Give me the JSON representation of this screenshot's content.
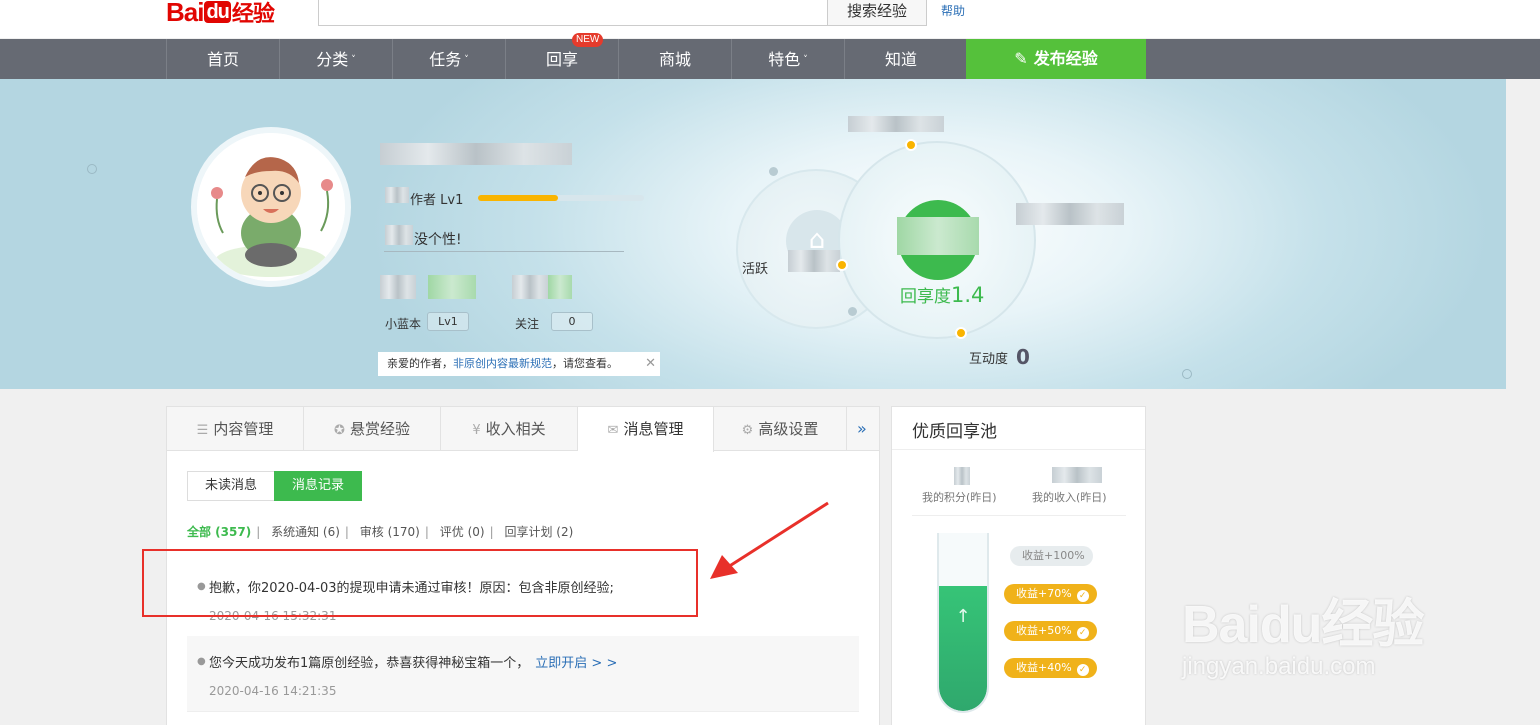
{
  "header": {
    "logo_text_bai": "Bai",
    "logo_text_du": "du",
    "logo_text_jy": "经验",
    "search_button": "搜索经验",
    "help_link": "帮助"
  },
  "nav": {
    "items": [
      {
        "label": "首页",
        "caret": false
      },
      {
        "label": "分类",
        "caret": true
      },
      {
        "label": "任务",
        "caret": true
      },
      {
        "label": "回享",
        "caret": false
      },
      {
        "label": "商城",
        "caret": false
      },
      {
        "label": "特色",
        "caret": true
      },
      {
        "label": "知道",
        "caret": false
      }
    ],
    "new_badge": "NEW",
    "publish_button": "发布经验"
  },
  "profile": {
    "author_level": "作者 Lv1",
    "level_progress_percent": 48,
    "signature": "没个性!",
    "xiaolanben_label": "小蓝本",
    "xiaolanben_value": "Lv1",
    "follow_label": "关注",
    "follow_value": "0",
    "notice_prefix": "亲爱的作者，",
    "notice_link": "非原创内容最新规范",
    "notice_suffix": "，请您查看。",
    "notice_close": "✕"
  },
  "stats": {
    "huoyue_label": "活跃",
    "huixiang_label": "回享度",
    "huixiang_value": "1.4",
    "hudong_label": "互动度",
    "hudong_value": "0"
  },
  "tabs": [
    {
      "label": "内容管理",
      "icon": "list-icon"
    },
    {
      "label": "悬赏经验",
      "icon": "medal-icon"
    },
    {
      "label": "收入相关",
      "icon": "yen-icon"
    },
    {
      "label": "消息管理",
      "icon": "mail-icon",
      "active": true
    },
    {
      "label": "高级设置",
      "icon": "gear-icon"
    }
  ],
  "tab_more": "»",
  "subtabs": {
    "unread": "未读消息",
    "record": "消息记录"
  },
  "filters": {
    "all": "全部 (357)",
    "system": "系统通知 (6)",
    "review": "审核 (170)",
    "evaluate": "评优 (0)",
    "plan": "回享计划 (2)"
  },
  "messages": [
    {
      "text": "抱歉，你2020-04-03的提现申请未通过审核！原因：包含非原创经验;",
      "time": "2020-04-16 15:32:31"
    },
    {
      "text": "您今天成功发布1篇原创经验，恭喜获得神秘宝箱一个，",
      "link": "立即开启 > >",
      "time": "2020-04-16 14:21:35"
    }
  ],
  "pool": {
    "title": "优质回享池",
    "my_points": "我的积分(昨日)",
    "my_income": "我的收入(昨日)",
    "tags": [
      "收益+100%",
      "收益+70%",
      "收益+50%",
      "收益+40%"
    ],
    "fill_percent": 70
  },
  "watermark": {
    "main": "Baidu经验",
    "sub": "jingyan.baidu.com"
  },
  "colors": {
    "brand_red": "#e10602",
    "nav_bg": "#666a73",
    "publish_green": "#55c13b",
    "accent_green": "#3dba4e",
    "progress_orange": "#f9b400",
    "link_blue": "#2b6fb6",
    "highlight_red": "#e8302a"
  }
}
